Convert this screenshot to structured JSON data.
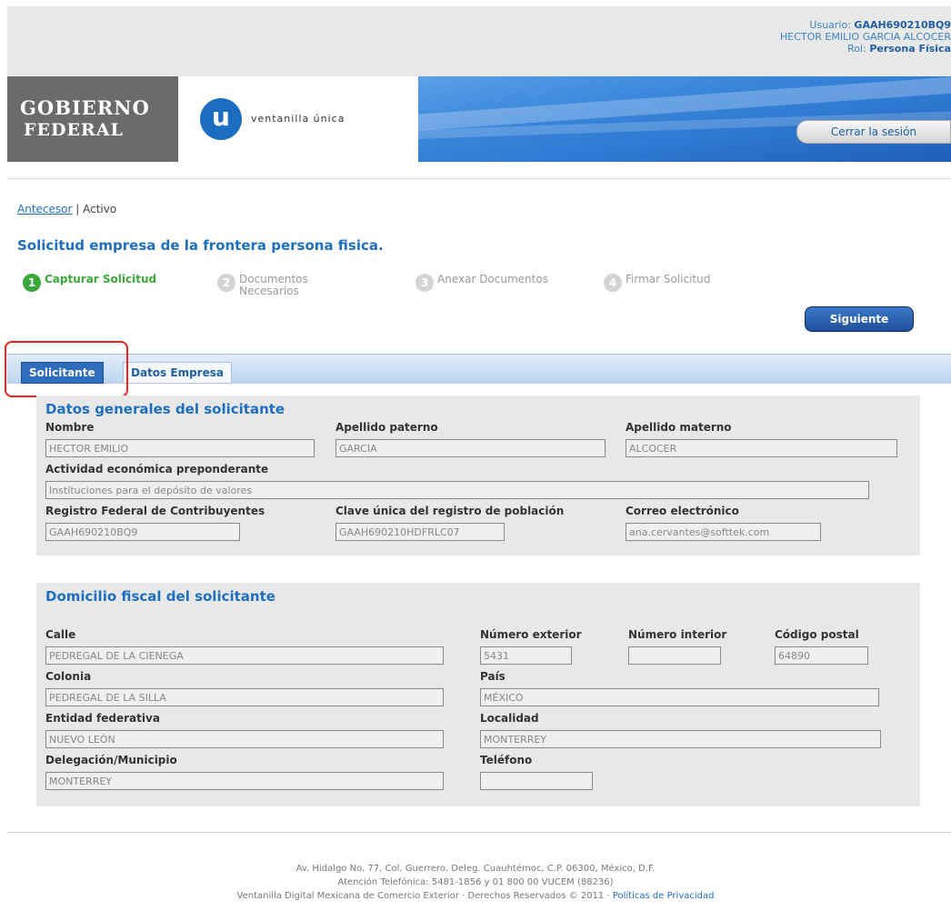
{
  "user": {
    "usuario_label": "Usuario:",
    "usuario_value": "GAAH690210BQ9",
    "name": "HECTOR EMILIO GARCIA ALCOCER",
    "rol_label": "Rol:",
    "rol_value": "Persona Física"
  },
  "header": {
    "gobierno_line1": "GOBIERNO",
    "gobierno_line2": "FEDERAL",
    "logo_letter": "u",
    "logo_text": "ventanilla única",
    "logout_label": "Cerrar la sesión"
  },
  "breadcrumb": {
    "link": "Antecesor",
    "separator": "|",
    "current": "Activo"
  },
  "page_title": "Solicitud empresa de la frontera persona fisica.",
  "steps": [
    {
      "num": "1",
      "label": "Capturar Solicitud"
    },
    {
      "num": "2",
      "label_line1": "Documentos",
      "label_line2": "Necesarios"
    },
    {
      "num": "3",
      "label": "Anexar Documentos"
    },
    {
      "num": "4",
      "label": "Firmar Solicitud"
    }
  ],
  "next_button": "Siguiente",
  "tabs": [
    {
      "label": "Solicitante"
    },
    {
      "label": "Datos Empresa"
    }
  ],
  "datos_generales": {
    "title": "Datos generales del solicitante",
    "nombre_label": "Nombre",
    "nombre": "HECTOR EMILIO",
    "ap_paterno_label": "Apellido paterno",
    "ap_paterno": "GARCIA",
    "ap_materno_label": "Apellido materno",
    "ap_materno": "ALCOCER",
    "actividad_label": "Actividad económica preponderante",
    "actividad": "Instituciones para el depósito de valores",
    "rfc_label": "Registro Federal de Contribuyentes",
    "rfc": "GAAH690210BQ9",
    "curp_label": "Clave única del registro de población",
    "curp": "GAAH690210HDFRLC07",
    "correo_label": "Correo electrónico",
    "correo": "ana.cervantes@softtek.com"
  },
  "domicilio": {
    "title": "Domicilio fiscal del solicitante",
    "calle_label": "Calle",
    "calle": "PEDREGAL DE LA CIENEGA",
    "num_ext_label": "Número exterior",
    "num_ext": "5431",
    "num_int_label": "Número interior",
    "num_int": "",
    "cp_label": "Código postal",
    "cp": "64890",
    "colonia_label": "Colonia",
    "colonia": "PEDREGAL DE LA SILLA",
    "pais_label": "País",
    "pais": "MÉXICO",
    "entidad_label": "Entidad federativa",
    "entidad": "NUEVO LEÓN",
    "localidad_label": "Localidad",
    "localidad": "MONTERREY",
    "delegacion_label": "Delegación/Municipio",
    "delegacion": "MONTERREY",
    "telefono_label": "Teléfono",
    "telefono": ""
  },
  "footer": {
    "line1": "Av. Hidalgo No. 77, Col. Guerrero, Deleg. Cuauhtémoc, C.P. 06300, México, D.F.",
    "line2": "Atención Telefónica: 5481-1856 y 01 800 00 VUCEM (88236)",
    "line3": "Ventanilla Digital Mexicana de Comercio Exterior · Derechos Reservados © 2011 ·",
    "privacy_link": "Políticas de Privacidad"
  },
  "colors": {
    "accent_blue": "#1f6fc0",
    "step_active_green": "#3aa83a",
    "highlight_red": "#e22222"
  }
}
